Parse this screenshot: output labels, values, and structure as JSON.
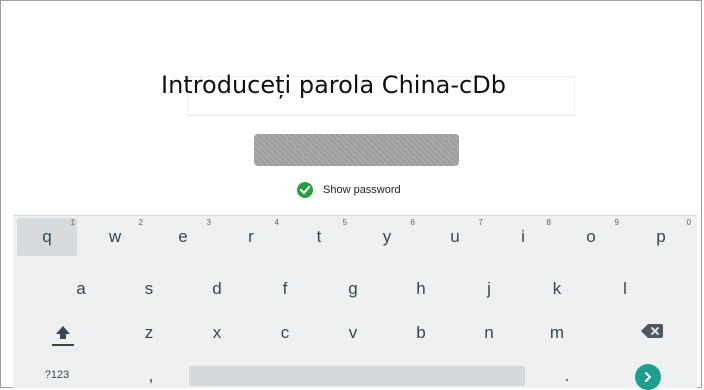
{
  "screen": {
    "title": "Introduceți parola China-cDb",
    "show_password_label": "Show password",
    "show_password_checked": true
  },
  "keyboard": {
    "row1": [
      {
        "key": "q",
        "hint": "1"
      },
      {
        "key": "w",
        "hint": "2"
      },
      {
        "key": "e",
        "hint": "3"
      },
      {
        "key": "r",
        "hint": "4"
      },
      {
        "key": "t",
        "hint": "5"
      },
      {
        "key": "y",
        "hint": "6"
      },
      {
        "key": "u",
        "hint": "7"
      },
      {
        "key": "i",
        "hint": "8"
      },
      {
        "key": "o",
        "hint": "9"
      },
      {
        "key": "p",
        "hint": "0"
      }
    ],
    "row2": [
      "a",
      "s",
      "d",
      "f",
      "g",
      "h",
      "j",
      "k",
      "l"
    ],
    "row3": [
      "z",
      "x",
      "c",
      "v",
      "b",
      "n",
      "m"
    ],
    "symbols_label": "?123",
    "comma": ",",
    "period": ".",
    "shift_icon": "shift-icon",
    "backspace_icon": "backspace-icon",
    "enter_icon": "chevron-right-icon"
  },
  "colors": {
    "accent_check": "#2e9c44",
    "go_button": "#1e9e8c",
    "keyboard_bg": "#eef0f1"
  }
}
